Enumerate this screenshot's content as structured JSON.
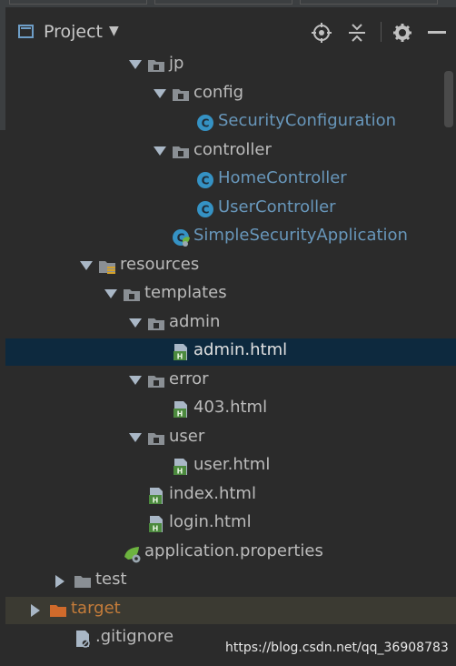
{
  "header": {
    "title": "Project"
  },
  "tree": [
    {
      "label": "jp",
      "depth": 5,
      "arrow": "down",
      "icon": "package-folder-icon"
    },
    {
      "label": "config",
      "depth": 6,
      "arrow": "down",
      "icon": "package-folder-icon"
    },
    {
      "label": "SecurityConfiguration",
      "depth": 7,
      "arrow": null,
      "icon": "java-class-icon",
      "color": "blue"
    },
    {
      "label": "controller",
      "depth": 6,
      "arrow": "down",
      "icon": "package-folder-icon"
    },
    {
      "label": "HomeController",
      "depth": 7,
      "arrow": null,
      "icon": "java-class-icon",
      "color": "blue"
    },
    {
      "label": "UserController",
      "depth": 7,
      "arrow": null,
      "icon": "java-class-icon",
      "color": "blue"
    },
    {
      "label": "SimpleSecurityApplication",
      "depth": 6,
      "arrow": null,
      "icon": "spring-boot-app-icon",
      "color": "blue"
    },
    {
      "label": "resources",
      "depth": 3,
      "arrow": "down",
      "icon": "resources-folder-icon"
    },
    {
      "label": "templates",
      "depth": 4,
      "arrow": "down",
      "icon": "package-folder-icon"
    },
    {
      "label": "admin",
      "depth": 5,
      "arrow": "down",
      "icon": "package-folder-icon"
    },
    {
      "label": "admin.html",
      "depth": 6,
      "arrow": null,
      "icon": "html-file-icon",
      "selected": true,
      "color": "white"
    },
    {
      "label": "error",
      "depth": 5,
      "arrow": "down",
      "icon": "package-folder-icon"
    },
    {
      "label": "403.html",
      "depth": 6,
      "arrow": null,
      "icon": "html-file-icon"
    },
    {
      "label": "user",
      "depth": 5,
      "arrow": "down",
      "icon": "package-folder-icon"
    },
    {
      "label": "user.html",
      "depth": 6,
      "arrow": null,
      "icon": "html-file-icon"
    },
    {
      "label": "index.html",
      "depth": 5,
      "arrow": null,
      "icon": "html-file-icon"
    },
    {
      "label": "login.html",
      "depth": 5,
      "arrow": null,
      "icon": "html-file-icon"
    },
    {
      "label": "application.properties",
      "depth": 4,
      "arrow": null,
      "icon": "spring-properties-icon"
    },
    {
      "label": "test",
      "depth": 2,
      "arrow": "right",
      "icon": "folder-icon"
    },
    {
      "label": "target",
      "depth": 1,
      "arrow": "right",
      "icon": "excluded-folder-icon",
      "color": "orange",
      "dark": true
    },
    {
      "label": ".gitignore",
      "depth": 2,
      "arrow": null,
      "icon": "ignore-file-icon"
    }
  ],
  "watermark": "https://blog.csdn.net/qq_36908783",
  "colors": {
    "background": "#2b2b2b",
    "selection": "#0d293e",
    "class_blue": "#6897bb",
    "excluded": "#c47c3a"
  }
}
